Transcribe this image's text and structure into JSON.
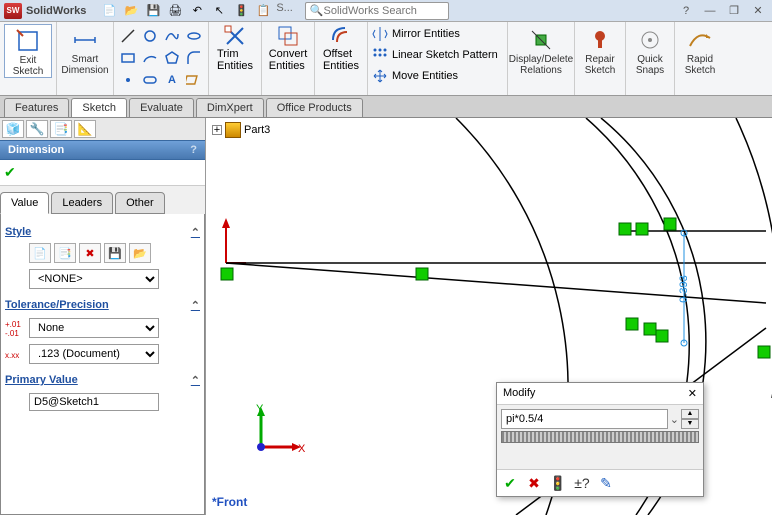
{
  "title": "SolidWorks",
  "search": {
    "placeholder": "SolidWorks Search",
    "short": "S..."
  },
  "ribbon": {
    "exit_sketch": "Exit\nSketch",
    "smart_dim": "Smart\nDimension",
    "trim": "Trim\nEntities",
    "convert": "Convert\nEntities",
    "offset": "Offset\nEntities",
    "mirror": "Mirror Entities",
    "pattern": "Linear Sketch Pattern",
    "move": "Move Entities",
    "display_delete": "Display/Delete\nRelations",
    "repair": "Repair\nSketch",
    "quick_snaps": "Quick\nSnaps",
    "rapid": "Rapid\nSketch"
  },
  "tabs": {
    "items": [
      "Features",
      "Sketch",
      "Evaluate",
      "DimXpert",
      "Office Products"
    ],
    "active": 1
  },
  "panel": {
    "title": "Dimension",
    "prop_tabs": [
      "Value",
      "Leaders",
      "Other"
    ],
    "prop_active": 0,
    "style": {
      "label": "Style",
      "select": "<NONE>"
    },
    "tolerance": {
      "label": "Tolerance/Precision",
      "type": "None",
      "precision": ".123 (Document)"
    },
    "primary": {
      "label": "Primary Value",
      "value": "D5@Sketch1"
    }
  },
  "doc": {
    "name": "Part3",
    "view": "*Front",
    "dim_value": "0.393"
  },
  "modify": {
    "title": "Modify",
    "value": "pi*0.5/4"
  }
}
